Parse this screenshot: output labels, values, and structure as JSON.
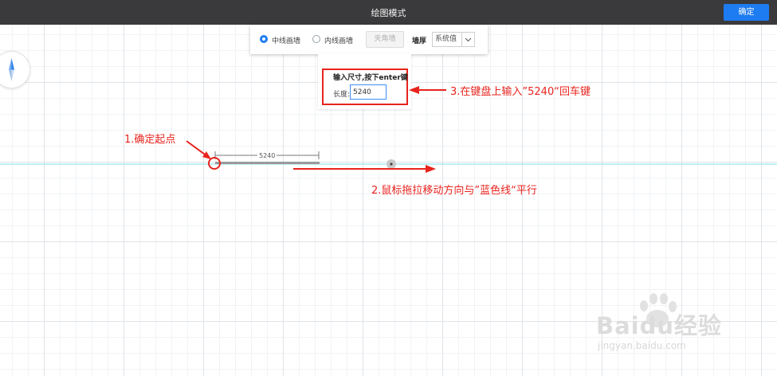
{
  "header": {
    "title": "绘图模式",
    "confirm_label": "确定"
  },
  "toolbar": {
    "radio_center": {
      "label": "中线画墙",
      "checked": true
    },
    "radio_inner": {
      "label": "内线画墙",
      "checked": false
    },
    "corner_button_label": "夹角墙",
    "wall_thickness_label": "墙厚",
    "wall_thickness_value": "系统值"
  },
  "input_panel": {
    "title": "输入尺寸,按下enter键",
    "length_label": "长度:",
    "length_value": "5240"
  },
  "drawing": {
    "dimension_label": "5240"
  },
  "annotations": {
    "step1": "1.确定起点",
    "step2": "2.鼠标拖拉移动方向与”蓝色线“平行",
    "step3": "3.在键盘上输入”5240“回车键"
  },
  "watermark": {
    "brand": "Baidu经验",
    "url": "jingyan.baidu.com"
  },
  "colors": {
    "accent": "#1e7cf2",
    "annotation": "#e8231d",
    "guide_line": "#7fe0ec",
    "topbar": "#3a3a3c"
  },
  "icons": {
    "compass": "compass-icon",
    "dropdown": "chevron-down-icon",
    "paw": "baidu-paw-icon"
  }
}
